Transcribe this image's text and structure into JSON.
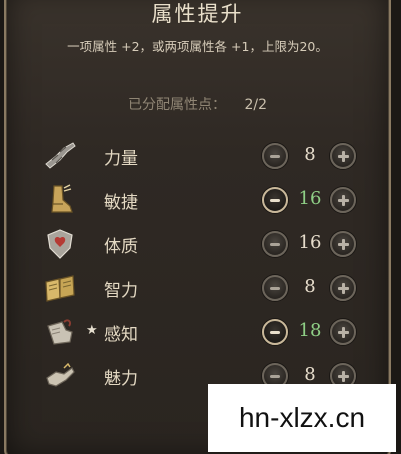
{
  "panel": {
    "title": "属性提升",
    "description": "一项属性 +2，或两项属性各 +1，上限为20。",
    "points_label": "已分配属性点：",
    "points_value": "2/2"
  },
  "attributes": [
    {
      "name": "力量",
      "value": "8",
      "raised": false,
      "icon": "strength-arm-icon",
      "star": ""
    },
    {
      "name": "敏捷",
      "value": "16",
      "raised": true,
      "icon": "dexterity-boot-icon",
      "star": ""
    },
    {
      "name": "体质",
      "value": "16",
      "raised": false,
      "icon": "constitution-shield-icon",
      "star": ""
    },
    {
      "name": "智力",
      "value": "8",
      "raised": false,
      "icon": "intelligence-book-icon",
      "star": ""
    },
    {
      "name": "感知",
      "value": "18",
      "raised": true,
      "icon": "wisdom-hand-icon",
      "star": "★"
    },
    {
      "name": "魅力",
      "value": "8",
      "raised": false,
      "icon": "charisma-hand-icon",
      "star": ""
    }
  ],
  "colors": {
    "raised_value": "#8fcf86",
    "normal_value": "#e6dccb",
    "panel_border": "#8a7a62"
  },
  "watermark": {
    "text": "hn-xlzx.cn"
  }
}
